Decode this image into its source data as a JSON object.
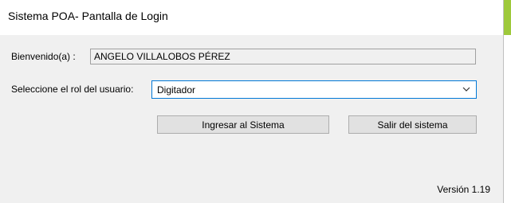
{
  "window": {
    "title": "Sistema POA- Pantalla de Login"
  },
  "welcome": {
    "label": "Bienvenido(a) :",
    "value": "ANGELO VILLALOBOS PÉREZ"
  },
  "role": {
    "label": "Seleccione el rol del usuario:",
    "selected": "Digitador",
    "dropdown_icon": "chevron-down-icon"
  },
  "buttons": {
    "login": "Ingresar al Sistema",
    "exit": "Salir del sistema"
  },
  "footer": {
    "version": "Versión 1.19"
  },
  "colors": {
    "window_bg": "#f0f0f0",
    "titlebar_bg": "#ffffff",
    "focus_border": "#0078d7",
    "button_bg": "#e1e1e1",
    "accent_strip": "#9ec93b"
  }
}
